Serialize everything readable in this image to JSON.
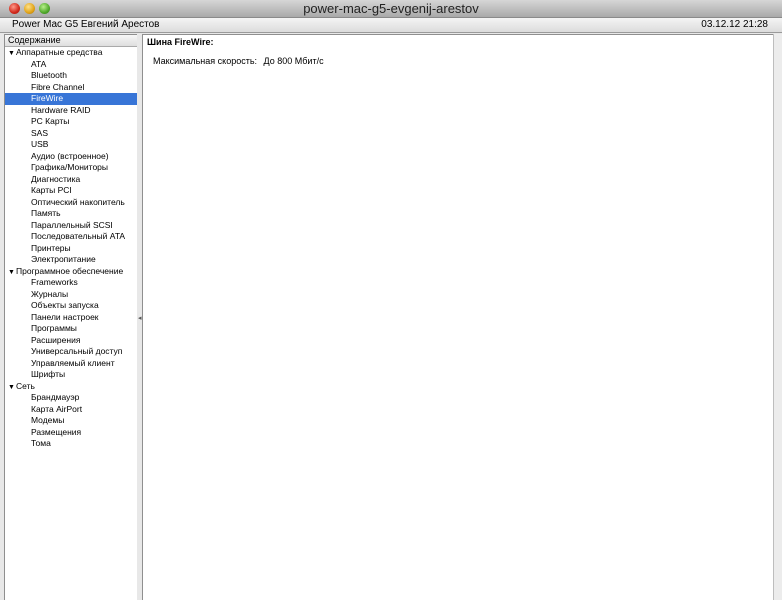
{
  "window": {
    "title": "power-mac-g5-evgenij-arestov"
  },
  "infobar": {
    "machine": "Power Mac G5 Евгений Арестов",
    "datetime": "03.12.12 21:28"
  },
  "sidebar": {
    "header": "Содержание",
    "groups": [
      {
        "label": "Аппаратные средства",
        "items": [
          "ATA",
          "Bluetooth",
          "Fibre Channel",
          "FireWire",
          "Hardware RAID",
          "PC Карты",
          "SAS",
          "USB",
          "Аудио (встроенное)",
          "Графика/Мониторы",
          "Диагностика",
          "Карты PCI",
          "Оптический накопитель",
          "Память",
          "Параллельный SCSI",
          "Последовательный ATA",
          "Принтеры",
          "Электропитание"
        ]
      },
      {
        "label": "Программное обеспечение",
        "items": [
          "Frameworks",
          "Журналы",
          "Объекты запуска",
          "Панели настроек",
          "Программы",
          "Расширения",
          "Универсальный доступ",
          "Управляемый клиент",
          "Шрифты"
        ]
      },
      {
        "label": "Сеть",
        "items": [
          "Брандмауэр",
          "Карта AirPort",
          "Модемы",
          "Размещения",
          "Тома"
        ]
      }
    ],
    "selected": "FireWire"
  },
  "content": {
    "title": "Шина FireWire:",
    "label": "Максимальная скорость:",
    "value": "До 800 Мбит/с"
  }
}
